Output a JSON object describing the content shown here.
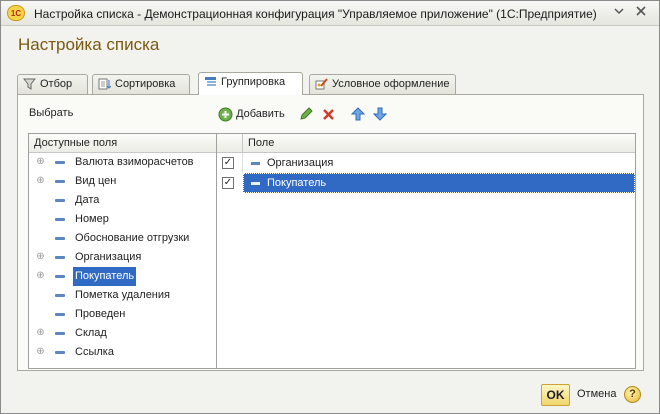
{
  "window": {
    "title": "Настройка списка - Демонстрационная конфигурация \"Управляемое приложение\" (1С:Предприятие)",
    "app_logo": "1С"
  },
  "form": {
    "heading": "Настройка списка"
  },
  "tabs": [
    {
      "label": "Отбор",
      "icon": "filter-icon",
      "active": false
    },
    {
      "label": "Сортировка",
      "icon": "sort-icon",
      "active": false
    },
    {
      "label": "Группировка",
      "icon": "grouping-icon",
      "active": true
    },
    {
      "label": "Условное оформление",
      "icon": "conditional-format-icon",
      "active": false
    }
  ],
  "left": {
    "choose_label": "Выбрать",
    "header": "Доступные поля",
    "items": [
      {
        "label": "Валюта взиморасчетов",
        "expandable": true
      },
      {
        "label": "Вид цен",
        "expandable": true
      },
      {
        "label": "Дата",
        "expandable": false
      },
      {
        "label": "Номер",
        "expandable": false
      },
      {
        "label": "Обоснование отгрузки",
        "expandable": false
      },
      {
        "label": "Организация",
        "expandable": true
      },
      {
        "label": "Покупатель",
        "expandable": true,
        "selected": true
      },
      {
        "label": "Пометка удаления",
        "expandable": false
      },
      {
        "label": "Проведен",
        "expandable": false
      },
      {
        "label": "Склад",
        "expandable": true
      },
      {
        "label": "Ссылка",
        "expandable": true
      }
    ]
  },
  "toolbar": {
    "add_label": "Добавить"
  },
  "right": {
    "column_header": "Поле",
    "rows": [
      {
        "checked": true,
        "label": "Организация",
        "selected": false
      },
      {
        "checked": true,
        "label": "Покупатель",
        "selected": true
      }
    ]
  },
  "footer": {
    "ok_label": "OK",
    "cancel_label": "Отмена",
    "help_label": "?"
  },
  "colors": {
    "accent": "#7a5a10",
    "selection": "#316ac5",
    "ok_button": "#f0d66c"
  }
}
